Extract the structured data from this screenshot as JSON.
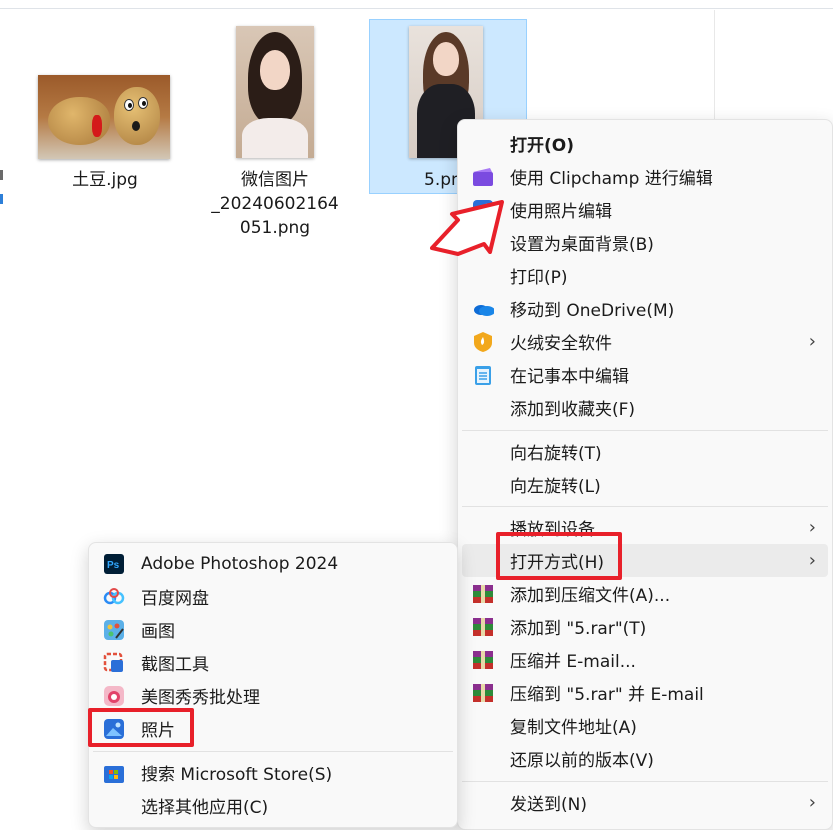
{
  "files": [
    {
      "name_line1": "土豆.jpg",
      "name_line2": "",
      "name_line3": ""
    },
    {
      "name_line1": "微信图片",
      "name_line2": "_20240602164",
      "name_line3": "051.png"
    },
    {
      "name_line1": "5.png",
      "name_line2": "",
      "name_line3": ""
    }
  ],
  "context_menu": {
    "items": [
      {
        "label": "打开(O)",
        "icon": "none"
      },
      {
        "label": "使用 Clipchamp 进行编辑",
        "icon": "clipchamp-icon"
      },
      {
        "label": "使用照片编辑",
        "icon": "photos-icon"
      },
      {
        "label": "设置为桌面背景(B)",
        "icon": "none"
      },
      {
        "label": "打印(P)",
        "icon": "none"
      },
      {
        "label": "移动到 OneDrive(M)",
        "icon": "onedrive-icon"
      },
      {
        "label": "火绒安全软件",
        "icon": "huorong-icon",
        "arrow": "›"
      },
      {
        "label": "在记事本中编辑",
        "icon": "notepad-icon"
      },
      {
        "label": "添加到收藏夹(F)",
        "icon": "none"
      },
      {
        "label": "向右旋转(T)",
        "icon": "none"
      },
      {
        "label": "向左旋转(L)",
        "icon": "none"
      },
      {
        "label": "播放到设备",
        "icon": "none",
        "arrow": "›"
      },
      {
        "label": "打开方式(H)",
        "icon": "none",
        "arrow": "›"
      },
      {
        "label": "添加到压缩文件(A)...",
        "icon": "winrar-icon"
      },
      {
        "label": "添加到 \"5.rar\"(T)",
        "icon": "winrar-icon"
      },
      {
        "label": "压缩并 E-mail...",
        "icon": "winrar-icon"
      },
      {
        "label": "压缩到 \"5.rar\" 并 E-mail",
        "icon": "winrar-icon"
      },
      {
        "label": "复制文件地址(A)",
        "icon": "none"
      },
      {
        "label": "还原以前的版本(V)",
        "icon": "none"
      },
      {
        "label": "发送到(N)",
        "icon": "none",
        "arrow": "›"
      }
    ]
  },
  "open_with_menu": {
    "items": [
      {
        "label": "Adobe Photoshop 2024",
        "icon": "photoshop-icon"
      },
      {
        "label": "百度网盘",
        "icon": "baidu-netdisk-icon"
      },
      {
        "label": "画图",
        "icon": "paint-icon"
      },
      {
        "label": "截图工具",
        "icon": "snipping-tool-icon"
      },
      {
        "label": "美图秀秀批处理",
        "icon": "meitu-icon"
      },
      {
        "label": "照片",
        "icon": "photos-icon"
      },
      {
        "label": "搜索 Microsoft Store(S)",
        "icon": "store-icon"
      },
      {
        "label": "选择其他应用(C)",
        "icon": "none"
      }
    ]
  },
  "icons": {
    "ps_text": "Ps"
  },
  "colors": {
    "highlight_box": "#e8202a",
    "selection_bg": "#cce8ff",
    "menu_bg": "#f9f9f9"
  }
}
